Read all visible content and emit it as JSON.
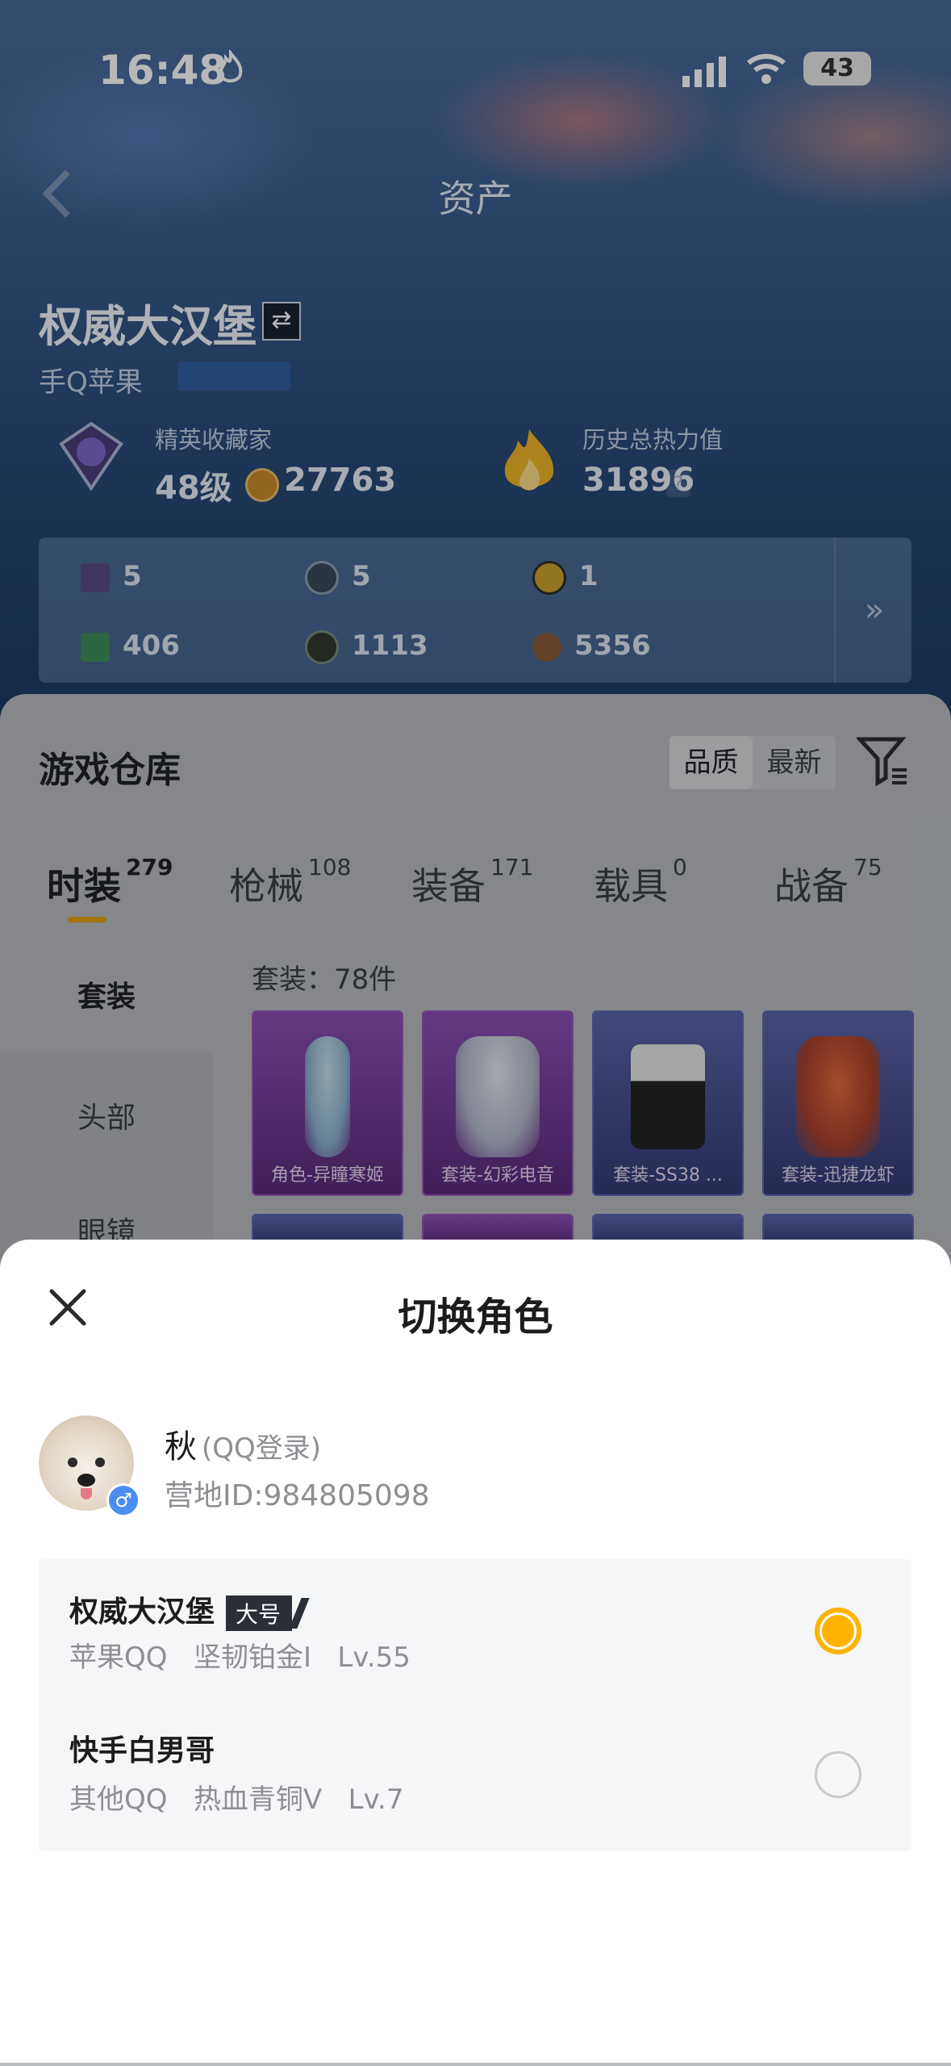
{
  "status_bar": {
    "time": "16:48",
    "battery": "43"
  },
  "header": {
    "title": "资产",
    "back_icon": "chevron-left-icon"
  },
  "profile": {
    "name": "权威大汉堡",
    "platform": "手Q苹果",
    "collector_label": "精英收藏家",
    "level": "48级",
    "coins": "27763",
    "heat_label": "历史总热力值",
    "heat_value": "31896",
    "heat_help": "?"
  },
  "resources": [
    {
      "value": "5",
      "color": "#5b4a8a"
    },
    {
      "value": "5",
      "color": "#3a4a5a"
    },
    {
      "value": "1",
      "color": "#c9a22e"
    },
    {
      "value": "406",
      "color": "#3e8f5a"
    },
    {
      "value": "1113",
      "color": "#2e3a30"
    },
    {
      "value": "5356",
      "color": "#8a5a3a"
    }
  ],
  "resources_more": "»",
  "warehouse": {
    "title": "游戏仓库",
    "sort_quality": "品质",
    "sort_latest": "最新",
    "tabs": [
      {
        "label": "时装",
        "count": "279"
      },
      {
        "label": "枪械",
        "count": "108"
      },
      {
        "label": "装备",
        "count": "171"
      },
      {
        "label": "载具",
        "count": "0"
      },
      {
        "label": "战备",
        "count": "75"
      }
    ],
    "side": [
      "套装",
      "头部",
      "眼镜"
    ],
    "count_text": "套装：78件",
    "cards": [
      {
        "label": "角色-异瞳寒姬"
      },
      {
        "label": "套装-幻彩电音"
      },
      {
        "label": "套装-SS38 ..."
      },
      {
        "label": "套装-迅捷龙虾"
      }
    ]
  },
  "sheet": {
    "title": "切换角色",
    "user_name": "秋",
    "login_type": "(QQ登录)",
    "camp_id": "营地ID:984805098",
    "gender_symbol": "♂",
    "roles": [
      {
        "name": "权威大汉堡",
        "tag": "大号",
        "info": "苹果QQ   坚韧铂金Ⅰ   Lv.55",
        "selected": true
      },
      {
        "name": "快手白男哥",
        "tag": "",
        "info": "其他QQ   热血青铜Ⅴ   Lv.7",
        "selected": false
      }
    ]
  },
  "colors": {
    "accent": "#ffb300",
    "tab_underline": "#e0a100",
    "link": "#2f7fe6"
  }
}
